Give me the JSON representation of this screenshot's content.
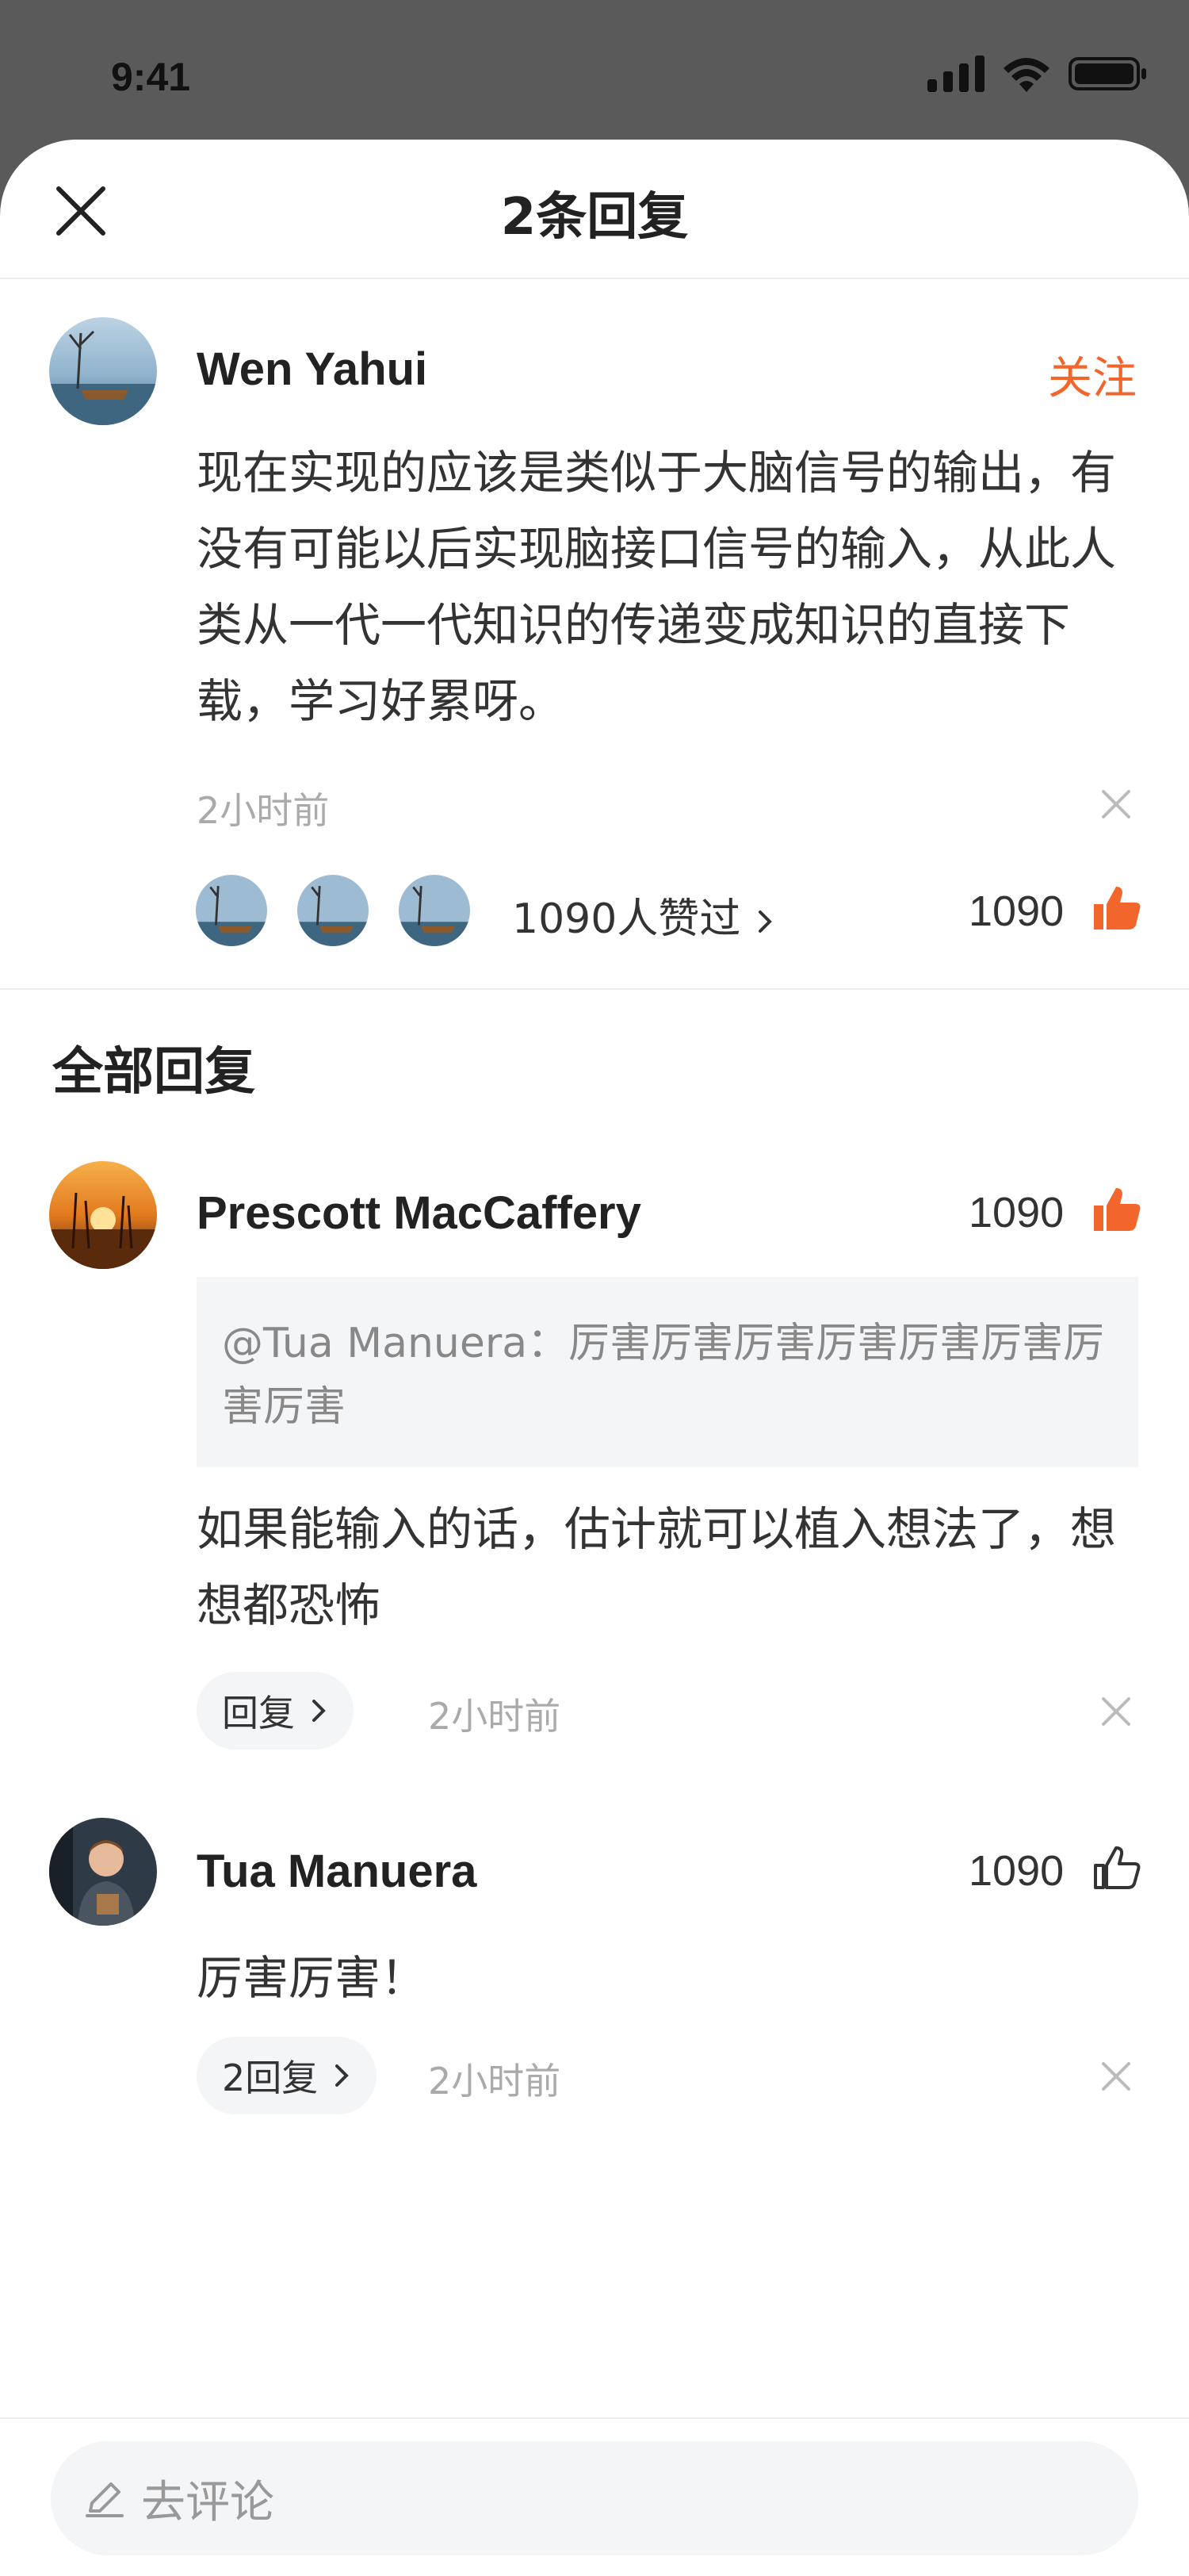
{
  "status_bar": {
    "time": "9:41"
  },
  "header": {
    "title": "2条回复",
    "close_icon": "close-icon"
  },
  "main_comment": {
    "author": "Wen Yahui",
    "follow_label": "关注",
    "text": "现在实现的应该是类似于大脑信号的输出，有没有可能以后实现脑接口信号的输入，从此人类从一代一代知识的传递变成知识的直接下载，学习好累呀。",
    "time": "2小时前",
    "likes_link": "1090人赞过",
    "like_count": "1090"
  },
  "section": {
    "title": "全部回复"
  },
  "replies": [
    {
      "author": "Prescott MacCaffery",
      "like_count": "1090",
      "liked": true,
      "quote": "@Tua Manuera：厉害厉害厉害厉害厉害厉害厉害厉害",
      "text": "如果能输入的话，估计就可以植入想法了，想想都恐怖",
      "reply_label": "回复",
      "time": "2小时前"
    },
    {
      "author": "Tua Manuera",
      "like_count": "1090",
      "liked": false,
      "text": "厉害厉害！",
      "reply_label": "2回复",
      "time": "2小时前"
    }
  ],
  "bottom": {
    "comment_placeholder": "去评论"
  },
  "colors": {
    "accent": "#f2652b",
    "text": "#333333",
    "muted": "#aaaaaa",
    "pill_bg": "#f4f5f7"
  }
}
